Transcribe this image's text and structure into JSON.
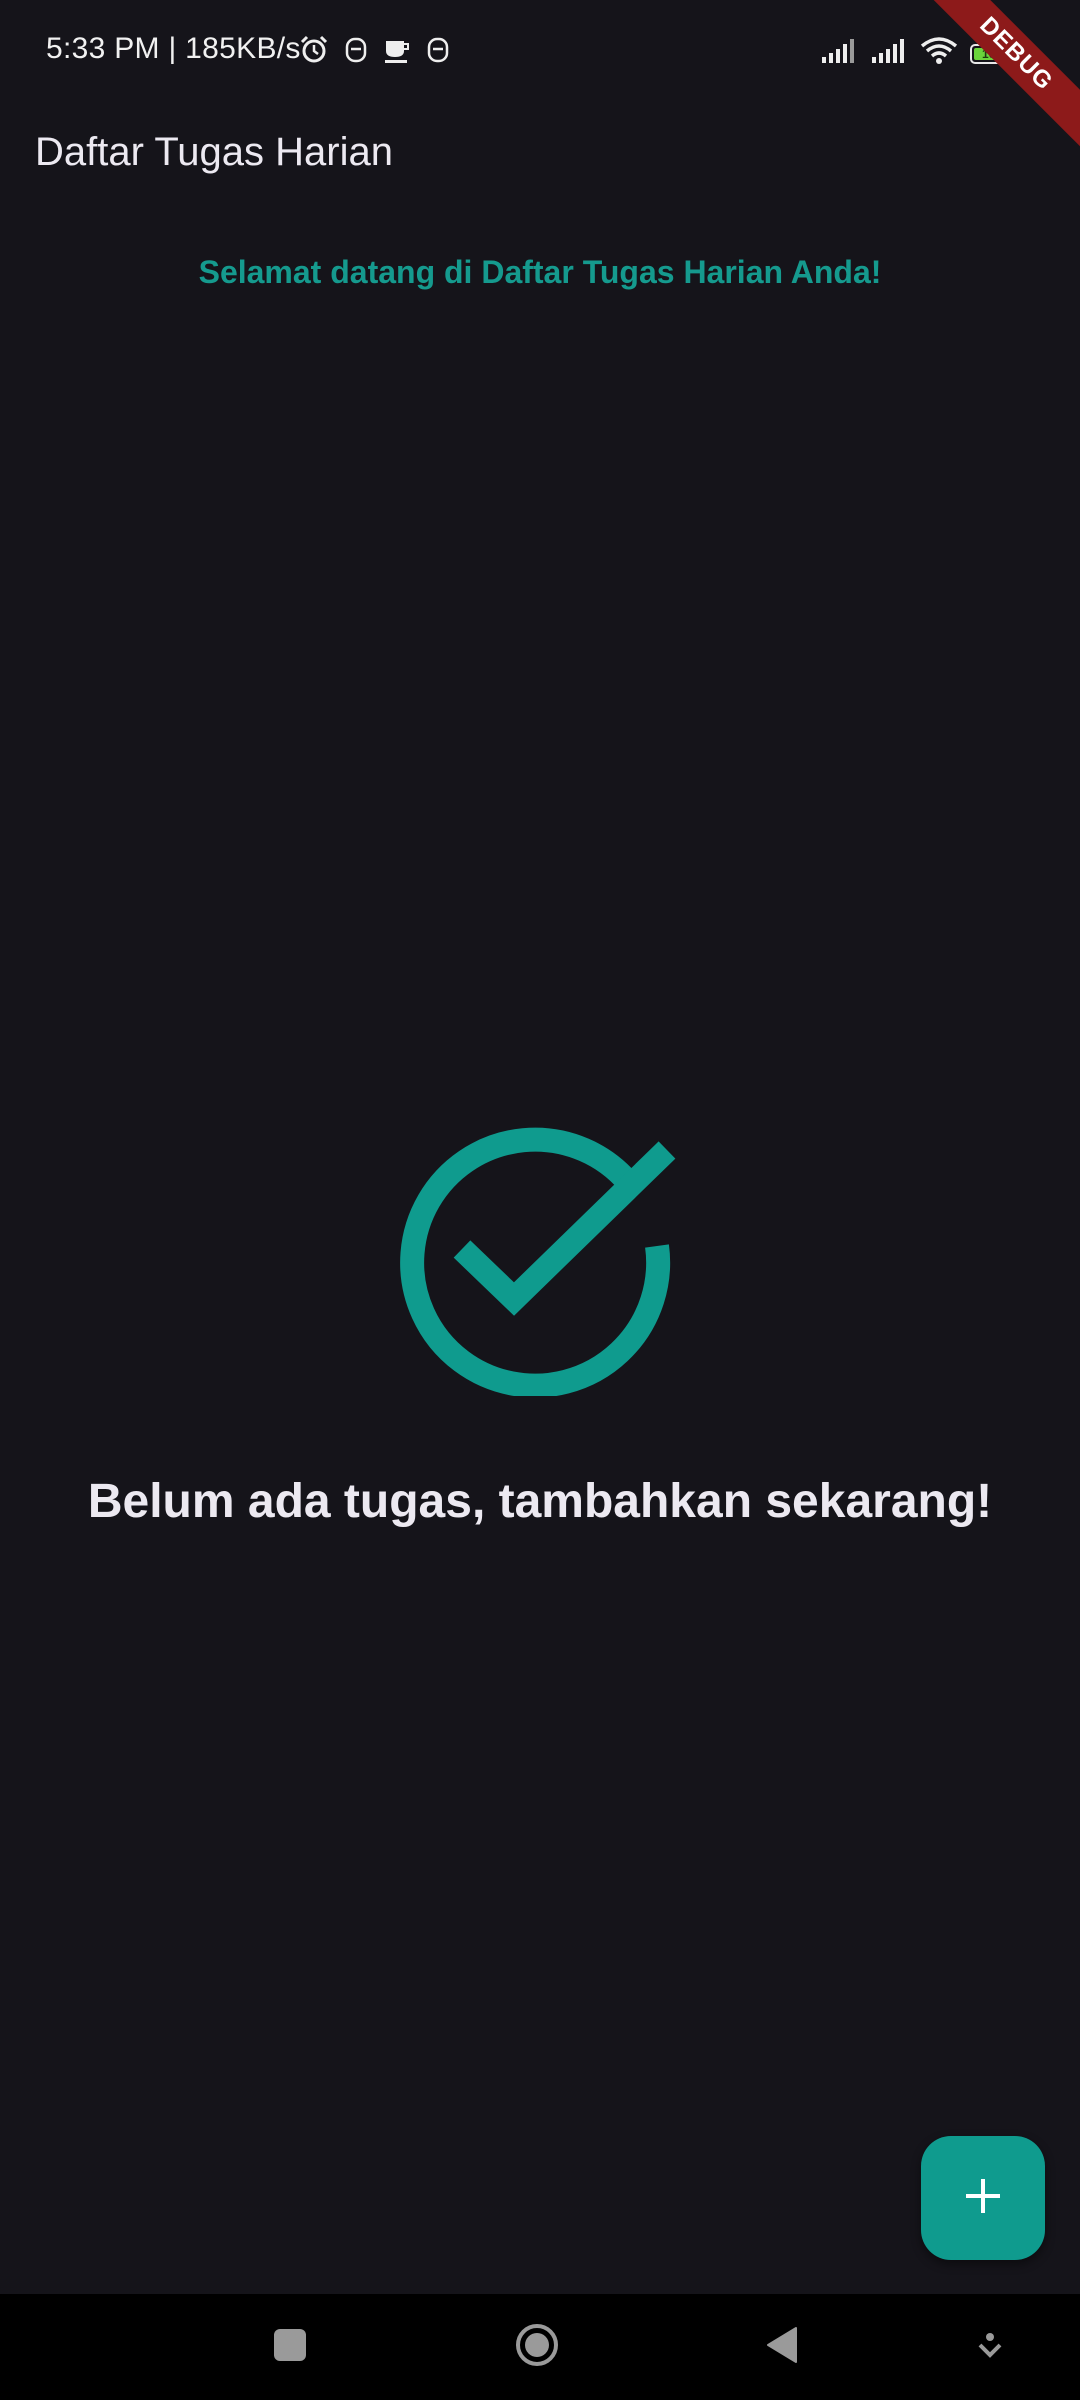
{
  "status_bar": {
    "time_speed": "5:33 PM | 185KB/s",
    "battery_level": "100",
    "icons_left": [
      "alarm-icon",
      "notification-icon",
      "coffee-icon",
      "notification-icon"
    ],
    "icons_right": [
      "signal-icon",
      "signal-icon",
      "wifi-icon",
      "battery-icon"
    ]
  },
  "debug_banner": "DEBUG",
  "app_bar": {
    "title": "Daftar Tugas Harian"
  },
  "welcome_text": "Selamat datang di Daftar Tugas Harian Anda!",
  "empty_state": {
    "icon": "check-circle-icon",
    "message": "Belum ada tugas, tambahkan sekarang!"
  },
  "fab": {
    "icon": "plus-icon"
  },
  "nav_bar": {
    "buttons": [
      "recents-button",
      "home-button",
      "back-button",
      "expand-button"
    ]
  },
  "colors": {
    "background": "#15141a",
    "accent": "#0f9b8e",
    "text_primary": "#ece9f1",
    "nav_background": "#000000",
    "debug_ribbon": "#8d1a1a"
  }
}
